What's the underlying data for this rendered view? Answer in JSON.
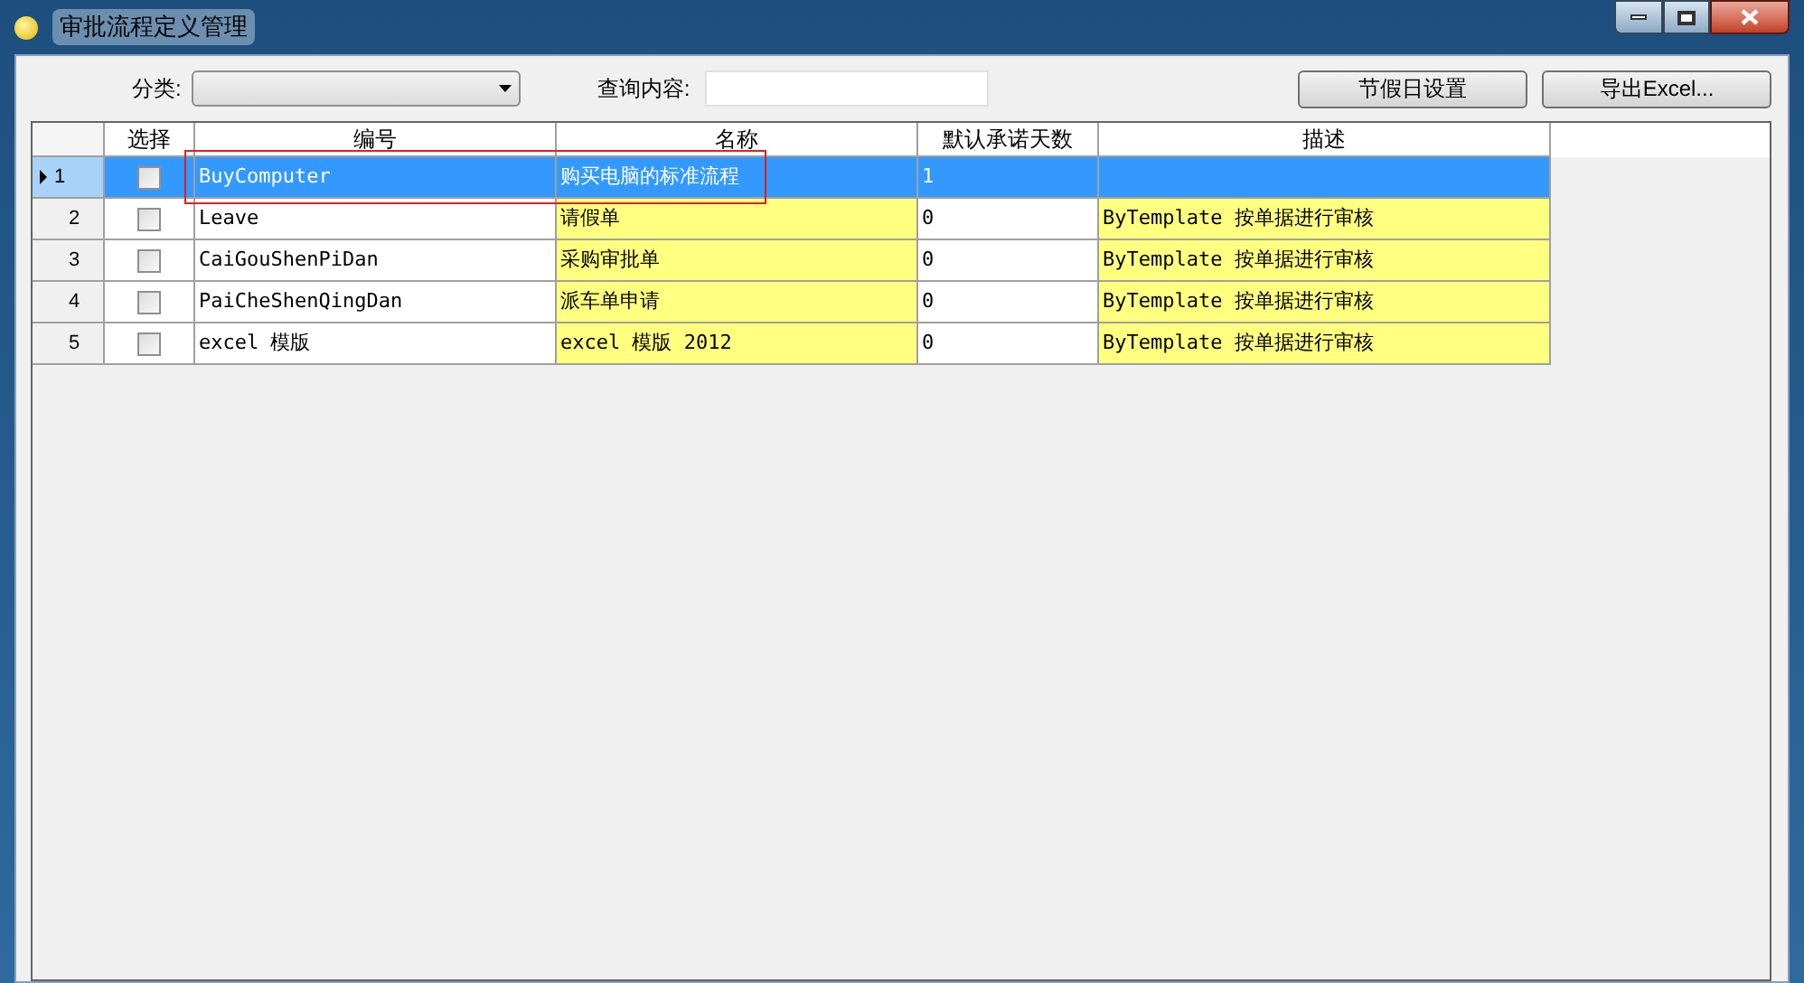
{
  "window": {
    "title": "审批流程定义管理"
  },
  "toolbar": {
    "category_label": "分类:",
    "query_label": "查询内容:",
    "buttons": [
      "节假日设置",
      "导出Excel..."
    ]
  },
  "table": {
    "columns": [
      {
        "label": "选择",
        "highlighted": false
      },
      {
        "label": "编号",
        "highlighted": false
      },
      {
        "label": "名称",
        "highlighted": true
      },
      {
        "label": "默认承诺天数",
        "highlighted": false
      },
      {
        "label": "描述",
        "highlighted": true
      }
    ],
    "rows": [
      {
        "number": "1",
        "selected": true,
        "checked": false,
        "cells": [
          "BuyComputer",
          "购买电脑的标准流程",
          "1",
          ""
        ]
      },
      {
        "number": "2",
        "selected": false,
        "checked": false,
        "cells": [
          "Leave",
          "请假单",
          "0",
          "ByTemplate 按单据进行审核"
        ]
      },
      {
        "number": "3",
        "selected": false,
        "checked": false,
        "cells": [
          "CaiGouShenPiDan",
          "采购审批单",
          "0",
          "ByTemplate 按单据进行审核"
        ]
      },
      {
        "number": "4",
        "selected": false,
        "checked": false,
        "cells": [
          "PaiCheShenQingDan",
          "派车单申请",
          "0",
          "ByTemplate 按单据进行审核"
        ]
      },
      {
        "number": "5",
        "selected": false,
        "checked": false,
        "cells": [
          "excel 模版",
          "excel 模版 2012",
          "0",
          "ByTemplate 按单据进行审核"
        ]
      }
    ]
  }
}
